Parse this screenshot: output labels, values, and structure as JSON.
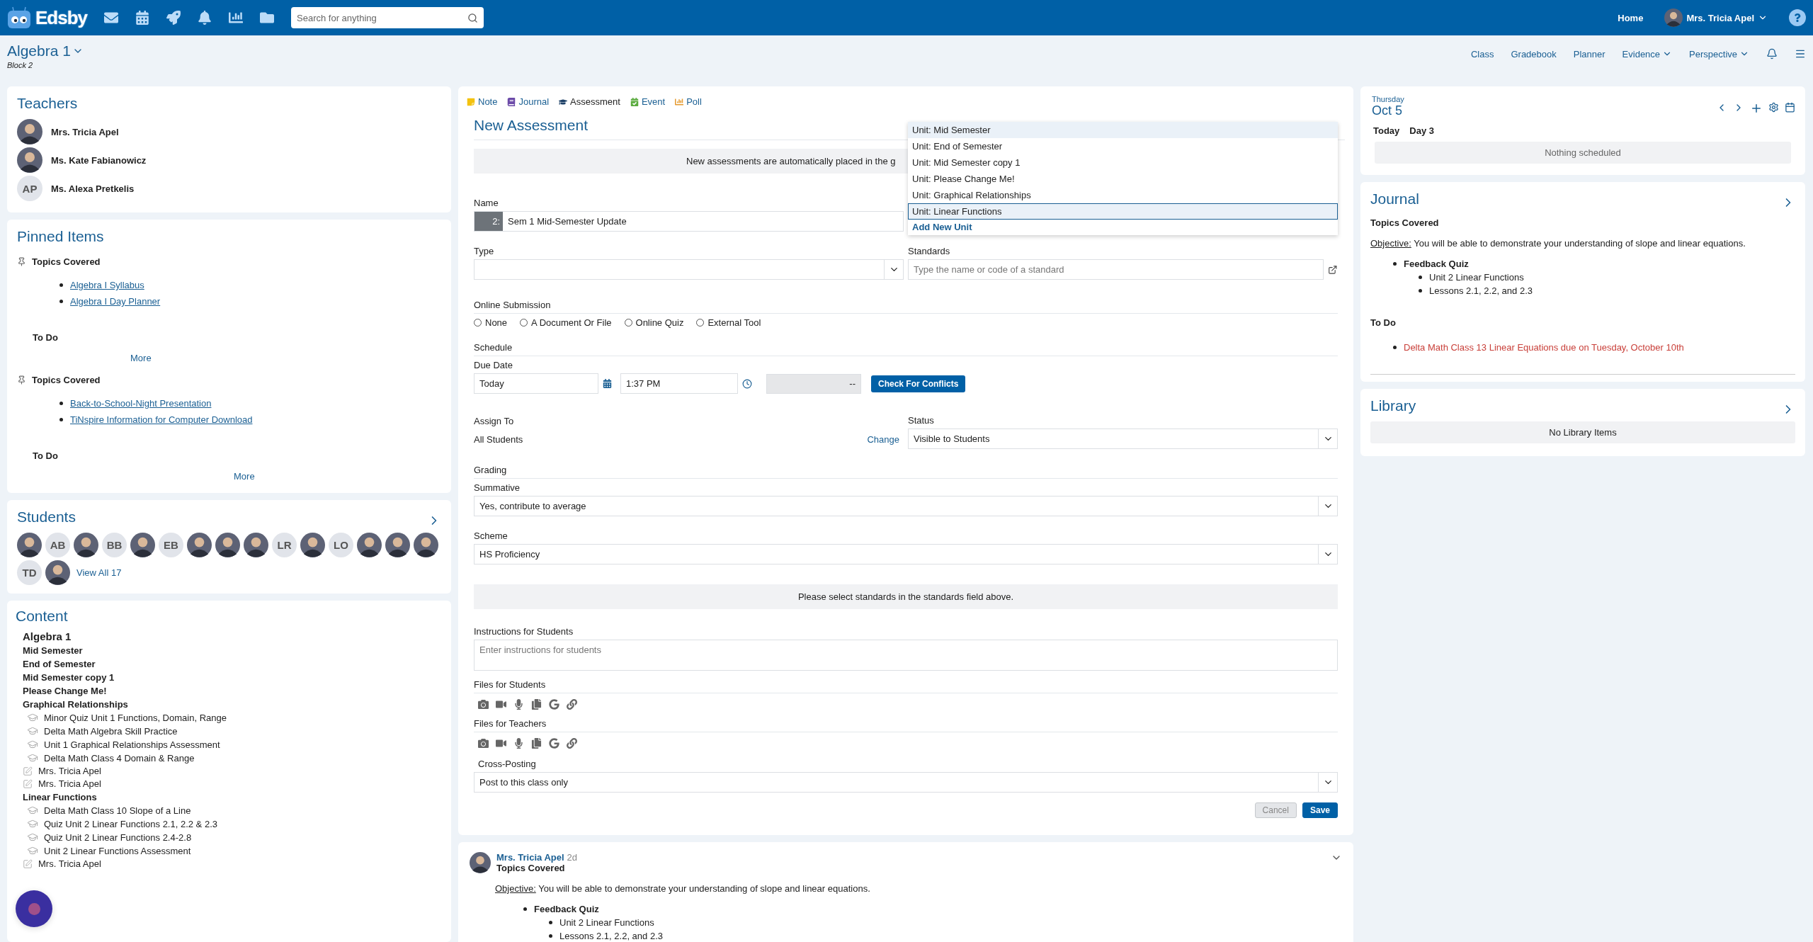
{
  "top_bar": {
    "logo_text": "Edsby",
    "icons": [
      {
        "kind": "mail"
      },
      {
        "kind": "calendar"
      },
      {
        "kind": "rocket"
      },
      {
        "kind": "bell"
      },
      {
        "kind": "chart"
      },
      {
        "kind": "folder"
      }
    ],
    "search": {
      "placeholder": "Search for anything"
    },
    "home": "Home",
    "user": "Mrs. Tricia Apel"
  },
  "class_header": {
    "title": "Algebra 1",
    "subtitle": "Block 2",
    "nav": [
      {
        "label": "Class",
        "menu": false
      },
      {
        "label": "Gradebook",
        "menu": false
      },
      {
        "label": "Planner",
        "menu": false
      },
      {
        "label": "Evidence",
        "menu": true
      },
      {
        "label": "Perspective",
        "menu": true
      }
    ]
  },
  "teachers": {
    "title": "Teachers",
    "items": [
      {
        "name": "Mrs. Tricia Apel",
        "avatar": {
          "kind": "photo"
        }
      },
      {
        "name": "Ms. Kate Fabianowicz",
        "avatar": {
          "kind": "photo"
        }
      },
      {
        "name": "Ms. Alexa Pretkelis",
        "avatar": {
          "kind": "initials",
          "initials": "AP"
        }
      }
    ]
  },
  "pinned": {
    "title": "Pinned Items",
    "items": [
      {
        "title": "Topics Covered",
        "links": [
          "Algebra I Syllabus",
          "Algebra I Day Planner"
        ],
        "todo": "To Do",
        "more": "More"
      },
      {
        "title": "Topics Covered",
        "links": [
          "Back-to-School-Night Presentation",
          "TiNspire Information for Computer Download"
        ],
        "todo": "To Do",
        "more": "More"
      }
    ]
  },
  "students": {
    "title": "Students",
    "items": [
      {
        "kind": "photo"
      },
      {
        "kind": "initials",
        "initials": "AB"
      },
      {
        "kind": "photo"
      },
      {
        "kind": "initials",
        "initials": "BB"
      },
      {
        "kind": "photo"
      },
      {
        "kind": "initials",
        "initials": "EB"
      },
      {
        "kind": "photo"
      },
      {
        "kind": "photo"
      },
      {
        "kind": "photo"
      },
      {
        "kind": "initials",
        "initials": "LR"
      },
      {
        "kind": "photo"
      },
      {
        "kind": "initials",
        "initials": "LO"
      },
      {
        "kind": "photo"
      },
      {
        "kind": "photo"
      },
      {
        "kind": "photo"
      },
      {
        "kind": "initials",
        "initials": "TD"
      },
      {
        "kind": "photo"
      }
    ],
    "view_all": "View All 17"
  },
  "content": {
    "title": "Content",
    "root": "Algebra 1",
    "units": [
      {
        "title": "Mid Semester"
      },
      {
        "title": "End of Semester"
      },
      {
        "title": "Mid Semester copy 1"
      },
      {
        "title": "Please Change Me!"
      },
      {
        "title": "Graphical Relationships",
        "children": [
          {
            "kind": "assessment",
            "label": "Minor Quiz Unit 1 Functions, Domain, Range"
          },
          {
            "kind": "assessment",
            "label": "Delta Math Algebra Skill Practice"
          },
          {
            "kind": "assessment",
            "label": "Unit 1 Graphical Relationships Assessment"
          },
          {
            "kind": "assessment",
            "label": "Delta Math Class 4 Domain & Range"
          },
          {
            "kind": "journal",
            "label": "Mrs. Tricia Apel"
          },
          {
            "kind": "journal",
            "label": "Mrs. Tricia Apel"
          }
        ]
      },
      {
        "title": "Linear Functions",
        "children": [
          {
            "kind": "assessment",
            "label": "Delta Math Class 10 Slope of a Line"
          },
          {
            "kind": "assessment",
            "label": "Quiz Unit 2 Linear Functions 2.1, 2.2 & 2.3"
          },
          {
            "kind": "assessment",
            "label": "Quiz Unit 2 Linear Functions 2.4-2.8"
          },
          {
            "kind": "assessment",
            "label": "Unit 2 Linear Functions Assessment"
          },
          {
            "kind": "journal",
            "label": "Mrs. Tricia Apel"
          }
        ]
      }
    ]
  },
  "composer": {
    "tabs": [
      {
        "kind": "note",
        "label": "Note",
        "selected": false
      },
      {
        "kind": "journal",
        "label": "Journal",
        "selected": false
      },
      {
        "kind": "assessment",
        "label": "Assessment",
        "selected": true
      },
      {
        "kind": "event",
        "label": "Event",
        "selected": false
      },
      {
        "kind": "poll",
        "label": "Poll",
        "selected": false
      }
    ],
    "title": "New Assessment",
    "notice": "New assessments are automatically placed in the g",
    "name": {
      "label": "Name",
      "prefix": "2:",
      "value": "Sem 1 Mid-Semester Update"
    },
    "unit_dropdown": {
      "options": [
        {
          "label": "Unit: Mid Semester",
          "hovered": true,
          "selected": false
        },
        {
          "label": "Unit: End of Semester",
          "hovered": false,
          "selected": false
        },
        {
          "label": "Unit: Mid Semester copy 1",
          "hovered": false,
          "selected": false
        },
        {
          "label": "Unit: Please Change Me!",
          "hovered": false,
          "selected": false
        },
        {
          "label": "Unit: Graphical Relationships",
          "hovered": false,
          "selected": false
        },
        {
          "label": "Unit: Linear Functions",
          "hovered": false,
          "selected": true
        }
      ],
      "add": "Add New Unit"
    },
    "type": {
      "label": "Type"
    },
    "standards": {
      "label": "Standards",
      "placeholder": "Type the name or code of a standard"
    },
    "online_submission": {
      "label": "Online Submission",
      "options": [
        {
          "label": "None",
          "selected": false
        },
        {
          "label": "A Document Or File",
          "selected": false
        },
        {
          "label": "Online Quiz",
          "selected": false
        },
        {
          "label": "External Tool",
          "selected": false
        }
      ]
    },
    "schedule": {
      "label": "Schedule",
      "due_label": "Due Date",
      "date": "Today",
      "time": "1:37 PM",
      "end": "--",
      "conflicts": "Check For Conflicts"
    },
    "assign": {
      "label": "Assign To",
      "value": "All Students",
      "change": "Change"
    },
    "status": {
      "label": "Status",
      "value": "Visible to Students"
    },
    "grading": {
      "label": "Grading",
      "summative_label": "Summative",
      "summative": "Yes, contribute to average",
      "scheme_label": "Scheme",
      "scheme": "HS Proficiency"
    },
    "standards_notice": "Please select standards in the standards field above.",
    "instructions": {
      "label": "Instructions for Students",
      "placeholder": "Enter instructions for students"
    },
    "files": [
      {
        "label": "Files for Students"
      },
      {
        "label": "Files for Teachers"
      }
    ],
    "cross_posting": {
      "label": "Cross-Posting",
      "value": "Post to this class only"
    },
    "cancel": "Cancel",
    "save": "Save"
  },
  "post": {
    "author": "Mrs. Tricia Apel",
    "age": "2d",
    "title": "Topics Covered",
    "objective_label": "Objective:",
    "objective": "You will be able to demonstrate your understanding of slope and linear equations.",
    "bullet": "Feedback Quiz",
    "sub_bullets": [
      "Unit 2 Linear Functions",
      "Lessons 2.1, 2.2, and 2.3"
    ]
  },
  "calendar": {
    "weekday": "Thursday",
    "date": "Oct 5",
    "today": "Today",
    "day": "Day 3",
    "empty": "Nothing scheduled"
  },
  "journal": {
    "title": "Journal",
    "heading": "Topics Covered",
    "objective_label": "Objective:",
    "objective": "You will be able to demonstrate your understanding of slope and linear equations.",
    "bullet": "Feedback Quiz",
    "sub_bullets": [
      "Unit 2 Linear Functions",
      "Lessons 2.1, 2.2, and 2.3"
    ],
    "todo": "To Do",
    "todo_items": [
      "Delta Math Class 13 Linear Equations due on Tuesday, October 10th"
    ]
  },
  "library": {
    "title": "Library",
    "empty": "No Library Items"
  }
}
